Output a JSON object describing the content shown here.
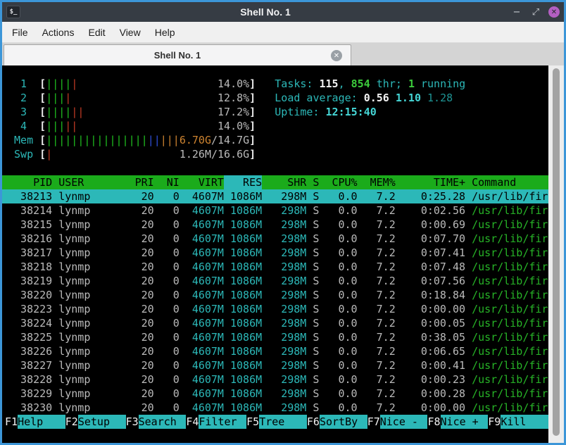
{
  "window": {
    "title": "Shell No. 1",
    "icon_glyph": "$_",
    "controls": {
      "minimize": "−",
      "restore": "⤢",
      "close": "✕"
    }
  },
  "menu": {
    "items": [
      "File",
      "Actions",
      "Edit",
      "View",
      "Help"
    ]
  },
  "tabs": [
    {
      "label": "Shell No. 1",
      "close": "✕"
    }
  ],
  "htop": {
    "meters": [
      {
        "id": "cpu1",
        "label": "1",
        "bars": [
          {
            "color": "green",
            "n": 4
          },
          {
            "color": "red",
            "n": 1
          }
        ],
        "value": [
          {
            "t": "14.0%",
            "c": "gray"
          }
        ]
      },
      {
        "id": "cpu2",
        "label": "2",
        "bars": [
          {
            "color": "green",
            "n": 3
          },
          {
            "color": "red",
            "n": 1
          }
        ],
        "value": [
          {
            "t": "12.8%",
            "c": "gray"
          }
        ]
      },
      {
        "id": "cpu3",
        "label": "3",
        "bars": [
          {
            "color": "green",
            "n": 4
          },
          {
            "color": "red",
            "n": 2
          }
        ],
        "value": [
          {
            "t": "17.2%",
            "c": "gray"
          }
        ]
      },
      {
        "id": "cpu4",
        "label": "4",
        "bars": [
          {
            "color": "green",
            "n": 3
          },
          {
            "color": "red",
            "n": 2
          }
        ],
        "value": [
          {
            "t": "14.0%",
            "c": "gray"
          }
        ]
      },
      {
        "id": "mem",
        "label": "Mem",
        "bars": [
          {
            "color": "green",
            "n": 16
          },
          {
            "color": "blue",
            "n": 2
          },
          {
            "color": "orange",
            "n": 3
          }
        ],
        "value": [
          {
            "t": "6.70G",
            "c": "orange"
          },
          {
            "t": "/14.7G",
            "c": "gray"
          }
        ]
      },
      {
        "id": "swp",
        "label": "Swp",
        "bars": [
          {
            "color": "red",
            "n": 1
          }
        ],
        "value": [
          {
            "t": "1.26M/16.6G",
            "c": "gray"
          }
        ]
      }
    ],
    "info": [
      {
        "id": "tasks-summary",
        "segments": [
          {
            "t": "Tasks: ",
            "c": "cyan"
          },
          {
            "t": "115",
            "c": "white-b"
          },
          {
            "t": ", ",
            "c": "cyan"
          },
          {
            "t": "854",
            "c": "green-b"
          },
          {
            "t": " thr; ",
            "c": "cyan"
          },
          {
            "t": "1",
            "c": "green-b"
          },
          {
            "t": " running",
            "c": "cyan"
          }
        ]
      },
      {
        "id": "load-average",
        "segments": [
          {
            "t": "Load average: ",
            "c": "cyan"
          },
          {
            "t": "0.56 ",
            "c": "white-b"
          },
          {
            "t": "1.10 ",
            "c": "cyan-b"
          },
          {
            "t": "1.28",
            "c": "cyan-dim"
          }
        ]
      },
      {
        "id": "uptime",
        "segments": [
          {
            "t": "Uptime: ",
            "c": "cyan"
          },
          {
            "t": "12:15:40",
            "c": "cyan-b"
          }
        ]
      }
    ],
    "table": {
      "headers": {
        "pid": "PID",
        "user": "USER",
        "pri": "PRI",
        "ni": "NI",
        "virt": "VIRT",
        "res": "RES",
        "shr": "SHR",
        "s": "S",
        "cpu": "CPU%",
        "mem": "MEM%",
        "time": "TIME+",
        "command": "Command"
      },
      "sort_column": "res",
      "rows": [
        {
          "pid": "38213",
          "user": "lynmp",
          "pri": "20",
          "ni": "0",
          "virt": "4607M",
          "res": "1086M",
          "shr": "298M",
          "s": "S",
          "cpu": "0.0",
          "mem": "7.2",
          "time": "0:25.28",
          "command": "/usr/lib/fir",
          "selected": true
        },
        {
          "pid": "38214",
          "user": "lynmp",
          "pri": "20",
          "ni": "0",
          "virt": "4607M",
          "res": "1086M",
          "shr": "298M",
          "s": "S",
          "cpu": "0.0",
          "mem": "7.2",
          "time": "0:02.56",
          "command": "/usr/lib/fir"
        },
        {
          "pid": "38215",
          "user": "lynmp",
          "pri": "20",
          "ni": "0",
          "virt": "4607M",
          "res": "1086M",
          "shr": "298M",
          "s": "S",
          "cpu": "0.0",
          "mem": "7.2",
          "time": "0:00.69",
          "command": "/usr/lib/fir"
        },
        {
          "pid": "38216",
          "user": "lynmp",
          "pri": "20",
          "ni": "0",
          "virt": "4607M",
          "res": "1086M",
          "shr": "298M",
          "s": "S",
          "cpu": "0.0",
          "mem": "7.2",
          "time": "0:07.70",
          "command": "/usr/lib/fir"
        },
        {
          "pid": "38217",
          "user": "lynmp",
          "pri": "20",
          "ni": "0",
          "virt": "4607M",
          "res": "1086M",
          "shr": "298M",
          "s": "S",
          "cpu": "0.0",
          "mem": "7.2",
          "time": "0:07.41",
          "command": "/usr/lib/fir"
        },
        {
          "pid": "38218",
          "user": "lynmp",
          "pri": "20",
          "ni": "0",
          "virt": "4607M",
          "res": "1086M",
          "shr": "298M",
          "s": "S",
          "cpu": "0.0",
          "mem": "7.2",
          "time": "0:07.48",
          "command": "/usr/lib/fir"
        },
        {
          "pid": "38219",
          "user": "lynmp",
          "pri": "20",
          "ni": "0",
          "virt": "4607M",
          "res": "1086M",
          "shr": "298M",
          "s": "S",
          "cpu": "0.0",
          "mem": "7.2",
          "time": "0:07.56",
          "command": "/usr/lib/fir"
        },
        {
          "pid": "38220",
          "user": "lynmp",
          "pri": "20",
          "ni": "0",
          "virt": "4607M",
          "res": "1086M",
          "shr": "298M",
          "s": "S",
          "cpu": "0.0",
          "mem": "7.2",
          "time": "0:18.84",
          "command": "/usr/lib/fir"
        },
        {
          "pid": "38223",
          "user": "lynmp",
          "pri": "20",
          "ni": "0",
          "virt": "4607M",
          "res": "1086M",
          "shr": "298M",
          "s": "S",
          "cpu": "0.0",
          "mem": "7.2",
          "time": "0:00.00",
          "command": "/usr/lib/fir"
        },
        {
          "pid": "38224",
          "user": "lynmp",
          "pri": "20",
          "ni": "0",
          "virt": "4607M",
          "res": "1086M",
          "shr": "298M",
          "s": "S",
          "cpu": "0.0",
          "mem": "7.2",
          "time": "0:00.05",
          "command": "/usr/lib/fir"
        },
        {
          "pid": "38225",
          "user": "lynmp",
          "pri": "20",
          "ni": "0",
          "virt": "4607M",
          "res": "1086M",
          "shr": "298M",
          "s": "S",
          "cpu": "0.0",
          "mem": "7.2",
          "time": "0:38.05",
          "command": "/usr/lib/fir"
        },
        {
          "pid": "38226",
          "user": "lynmp",
          "pri": "20",
          "ni": "0",
          "virt": "4607M",
          "res": "1086M",
          "shr": "298M",
          "s": "S",
          "cpu": "0.0",
          "mem": "7.2",
          "time": "0:06.65",
          "command": "/usr/lib/fir"
        },
        {
          "pid": "38227",
          "user": "lynmp",
          "pri": "20",
          "ni": "0",
          "virt": "4607M",
          "res": "1086M",
          "shr": "298M",
          "s": "S",
          "cpu": "0.0",
          "mem": "7.2",
          "time": "0:00.41",
          "command": "/usr/lib/fir"
        },
        {
          "pid": "38228",
          "user": "lynmp",
          "pri": "20",
          "ni": "0",
          "virt": "4607M",
          "res": "1086M",
          "shr": "298M",
          "s": "S",
          "cpu": "0.0",
          "mem": "7.2",
          "time": "0:00.23",
          "command": "/usr/lib/fir"
        },
        {
          "pid": "38229",
          "user": "lynmp",
          "pri": "20",
          "ni": "0",
          "virt": "4607M",
          "res": "1086M",
          "shr": "298M",
          "s": "S",
          "cpu": "0.0",
          "mem": "7.2",
          "time": "0:00.28",
          "command": "/usr/lib/fir"
        },
        {
          "pid": "38230",
          "user": "lynmp",
          "pri": "20",
          "ni": "0",
          "virt": "4607M",
          "res": "1086M",
          "shr": "298M",
          "s": "S",
          "cpu": "0.0",
          "mem": "7.2",
          "time": "0:00.00",
          "command": "/usr/lib/fir"
        }
      ]
    },
    "fkeys": [
      {
        "key": "F1",
        "label": "Help"
      },
      {
        "key": "F2",
        "label": "Setup"
      },
      {
        "key": "F3",
        "label": "Search"
      },
      {
        "key": "F4",
        "label": "Filter"
      },
      {
        "key": "F5",
        "label": "Tree"
      },
      {
        "key": "F6",
        "label": "SortBy"
      },
      {
        "key": "F7",
        "label": "Nice -"
      },
      {
        "key": "F8",
        "label": "Nice +"
      },
      {
        "key": "F9",
        "label": "Kill"
      }
    ]
  },
  "colors": {
    "border": "#3C96D8",
    "titlebar": "#363C44",
    "title-text": "#F1F2F3",
    "menubar": "#F0F0F0",
    "menu-text": "#1C1C1C",
    "tabbar": "#D4D4D4",
    "tab": "#F4F4F5",
    "tab-border": "#A6A6A6",
    "tab-text": "#303030",
    "close-btn": "#B35FC2",
    "terminal-bg": "#000000",
    "cyan": "#2CB8B8",
    "cyan-bright": "#45D5D5",
    "cyan-dim": "#1E9494",
    "green": "#27B427",
    "green-bright": "#3CCB3C",
    "gray": "#BABABA",
    "white": "#F2F2F2",
    "orange": "#CE8430",
    "bar-green": "#1FBF1F",
    "bar-red": "#C43B25",
    "bar-blue": "#2E4FD8",
    "header-bg": "#1BAB1B",
    "scroll-track": "#EDEDED",
    "scroll-thumb": "#A3A3A3"
  }
}
